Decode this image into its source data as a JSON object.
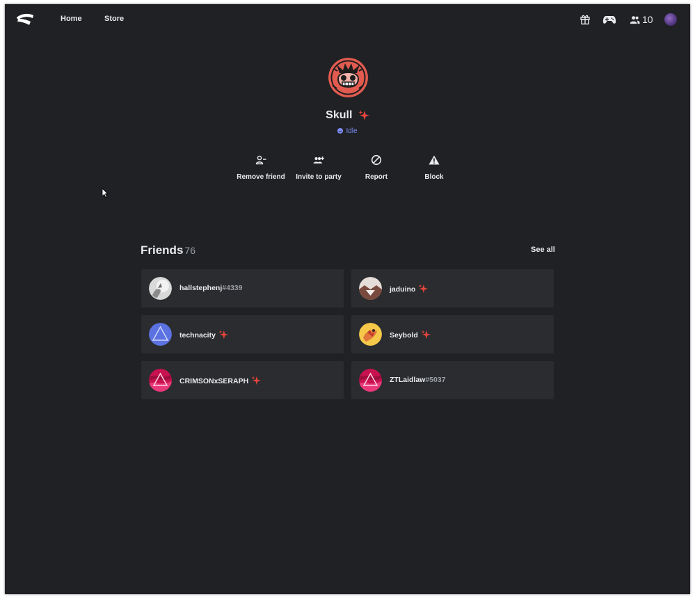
{
  "nav": {
    "home": "Home",
    "store": "Store",
    "friends_online": "10"
  },
  "profile": {
    "name": "Skull",
    "status": "Idle",
    "status_color": "#7c8cf5"
  },
  "actions": {
    "remove_friend": "Remove friend",
    "invite_to_party": "Invite to party",
    "report": "Report",
    "block": "Block"
  },
  "friends": {
    "title": "Friends",
    "count": "76",
    "see_all": "See all",
    "list": [
      {
        "name": "hallstephenj",
        "tag": "#4339",
        "pro": false,
        "avatar": "gray-moon"
      },
      {
        "name": "jaduino",
        "tag": "",
        "pro": true,
        "avatar": "brown-mountain"
      },
      {
        "name": "technacity",
        "tag": "",
        "pro": true,
        "avatar": "blue-triangle"
      },
      {
        "name": "Seybold",
        "tag": "",
        "pro": true,
        "avatar": "yellow-art"
      },
      {
        "name": "CRIMSONxSERAPH",
        "tag": "",
        "pro": true,
        "avatar": "pink-triangle"
      },
      {
        "name": "ZTLaidlaw",
        "tag": "#5037",
        "pro": false,
        "avatar": "pink-triangle"
      }
    ]
  },
  "colors": {
    "background": "#202124",
    "card": "#2b2c2f",
    "pro_sparkle": "#e8453c",
    "idle": "#7c8cf5"
  }
}
